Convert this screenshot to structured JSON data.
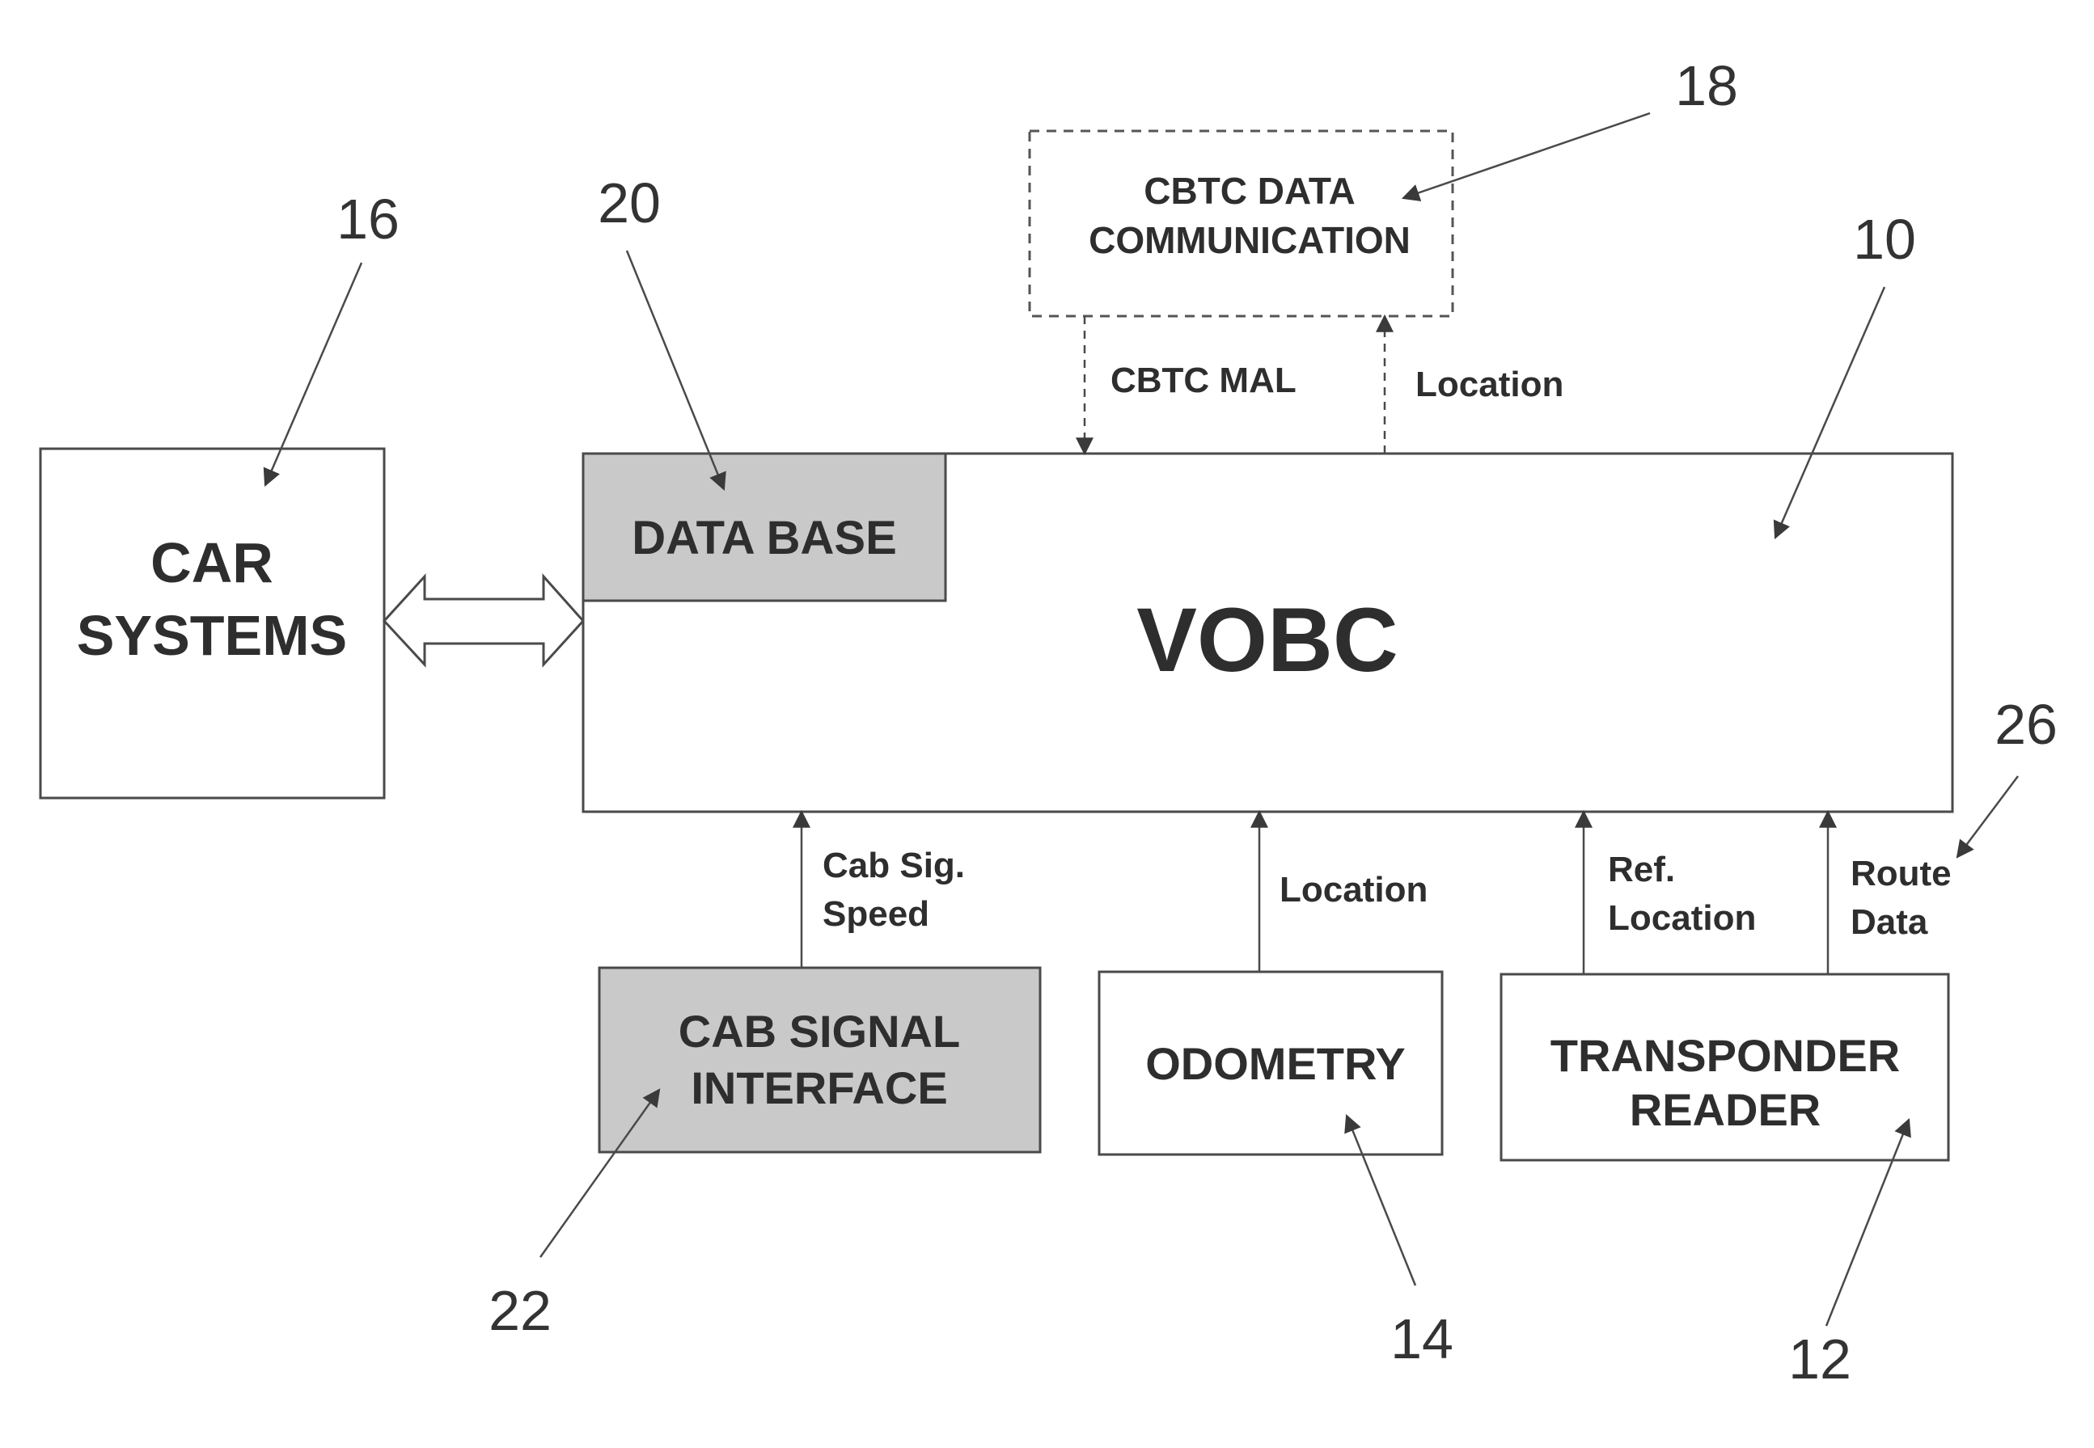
{
  "diagram": {
    "blocks": {
      "car_systems": {
        "lines": [
          "CAR",
          "SYSTEMS"
        ],
        "ref": "16"
      },
      "vobc": {
        "label": "VOBC",
        "ref": "10"
      },
      "data_base": {
        "label": "DATA BASE",
        "ref": "20",
        "fill": "#c9c9c9"
      },
      "cbtc": {
        "lines": [
          "CBTC DATA",
          "COMMUNICATION"
        ],
        "ref": "18",
        "border": "dashed"
      },
      "cab_signal": {
        "lines": [
          "CAB SIGNAL",
          "INTERFACE"
        ],
        "ref": "22",
        "fill": "#c9c9c9"
      },
      "odometry": {
        "label": "ODOMETRY",
        "ref": "14"
      },
      "transponder": {
        "lines": [
          "TRANSPONDER",
          "READER"
        ],
        "ref": "12"
      }
    },
    "signals": {
      "cbtc_mal": "CBTC MAL",
      "cbtc_location": "Location",
      "cab_sig_speed": [
        "Cab Sig.",
        "Speed"
      ],
      "odometry_location": "Location",
      "ref_location": [
        "Ref.",
        "Location"
      ],
      "route_data": [
        "Route",
        "Data"
      ],
      "route_data_ref": "26"
    }
  }
}
